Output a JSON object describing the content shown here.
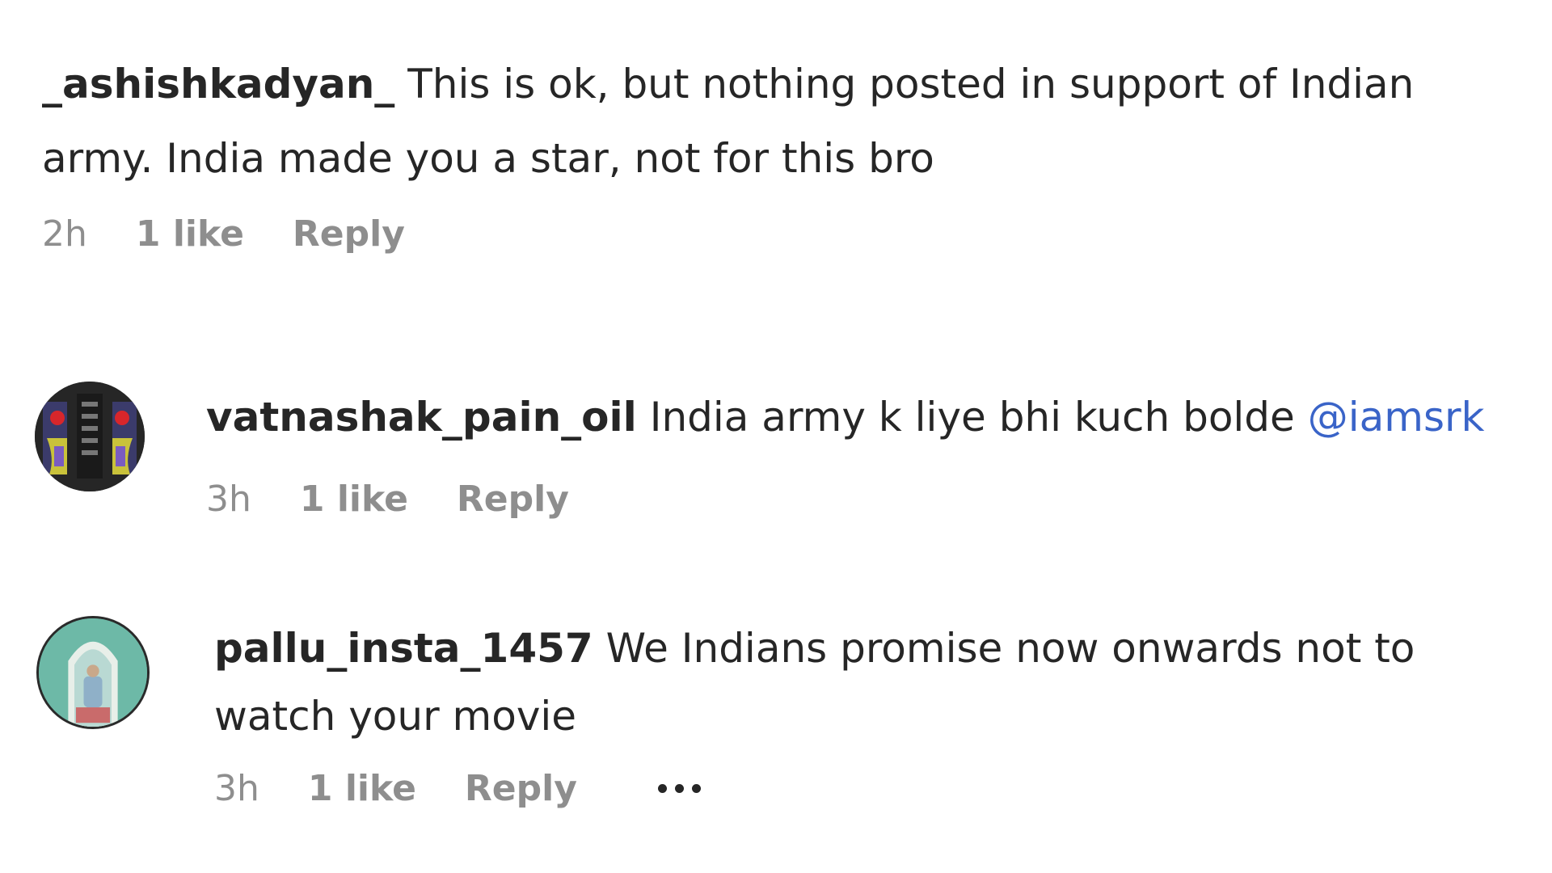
{
  "comments": [
    {
      "username": "_ashishkadyan_",
      "text": " This is ok, but nothing posted in support of Indian army. India made you a star, not for this bro",
      "mention": "",
      "time": "2h",
      "likes": "1 like",
      "reply_label": "Reply"
    },
    {
      "username": "vatnashak_pain_oil",
      "text": " India army k liye bhi kuch bolde ",
      "mention": "@iamsrk",
      "time": "3h",
      "likes": "1 like",
      "reply_label": "Reply"
    },
    {
      "username": "pallu_insta_1457",
      "text": " We Indians promise now onwards not to watch your movie",
      "mention": "",
      "time": "3h",
      "likes": "1 like",
      "reply_label": "Reply",
      "more_icon": "more-options-icon"
    }
  ]
}
